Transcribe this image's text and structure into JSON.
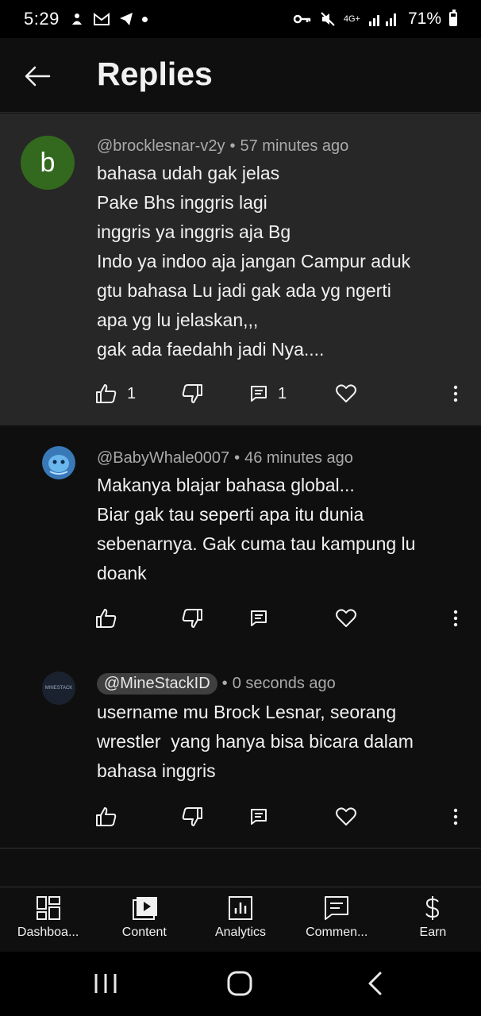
{
  "status_bar": {
    "time": "5:29",
    "battery": "71%",
    "network": "4G+"
  },
  "header": {
    "title": "Replies"
  },
  "comments": [
    {
      "avatar_letter": "b",
      "author": "@brocklesnar-v2y",
      "time": "57 minutes ago",
      "text": "bahasa udah gak jelas\nPake Bhs inggris lagi\ninggris ya inggris aja Bg\nIndo ya indoo aja jangan Campur aduk\ngtu bahasa Lu jadi gak ada yg ngerti\napa yg lu jelaskan,,,\ngak ada faedahh jadi Nya....",
      "likes": "1",
      "replies": "1"
    },
    {
      "author": "@BabyWhale0007",
      "time": "46 minutes ago",
      "text": "Makanya blajar bahasa global...\nBiar gak tau seperti apa itu dunia\nsebenarnya. Gak cuma tau kampung lu\ndoank"
    },
    {
      "author": "@MineStackID",
      "time": "0 seconds ago",
      "text": "username mu Brock Lesnar, seorang\nwrestler  yang hanya bisa bicara dalam\nbahasa inggris",
      "avatar_text": "MINESTACK"
    }
  ],
  "separator": "•",
  "bottom_nav": [
    {
      "label": "Dashboa...",
      "icon": "dashboard-icon"
    },
    {
      "label": "Content",
      "icon": "content-icon"
    },
    {
      "label": "Analytics",
      "icon": "analytics-icon"
    },
    {
      "label": "Commen...",
      "icon": "comments-icon"
    },
    {
      "label": "Earn",
      "icon": "earn-icon"
    }
  ],
  "colors": {
    "background": "#0f0f0f",
    "highlight": "#272727",
    "avatar_b": "#33691e",
    "meta_text": "#aaaaaa"
  }
}
